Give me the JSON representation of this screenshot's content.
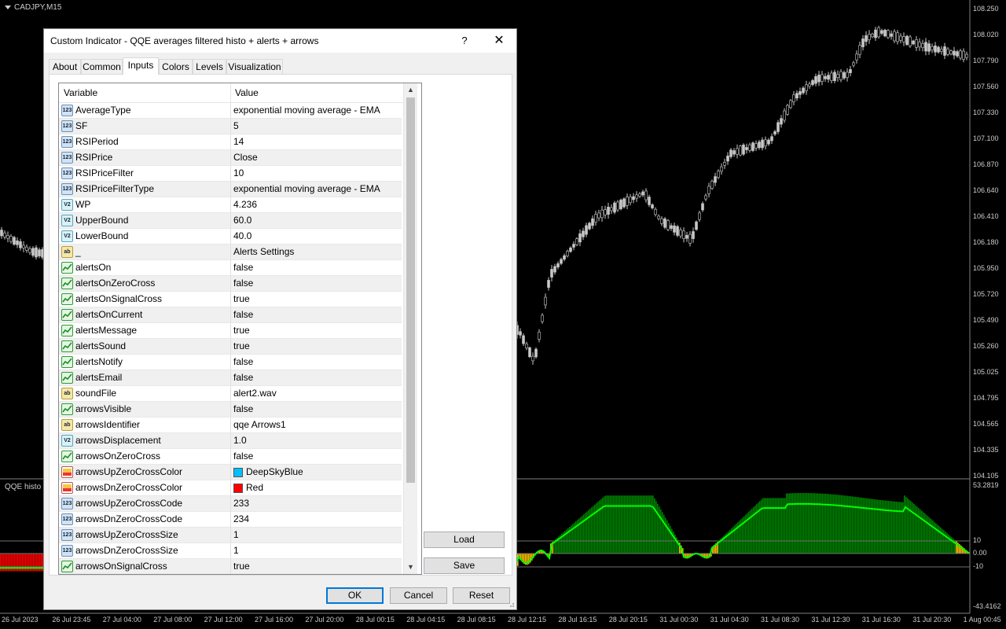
{
  "chart": {
    "symbol": "CADJPY,M15",
    "indicator_label": "QQE histo",
    "price_axis": [
      "108.250",
      "108.020",
      "107.790",
      "107.560",
      "107.330",
      "107.100",
      "106.870",
      "106.640",
      "106.410",
      "106.180",
      "105.950",
      "105.720",
      "105.490",
      "105.260",
      "105.025",
      "104.795",
      "104.565",
      "104.335",
      "104.105"
    ],
    "indicator_axis": [
      "53.2819",
      "10",
      "0.00",
      "-10",
      "-43.4162"
    ],
    "time_axis": [
      "26 Jul 2023",
      "26 Jul 23:45",
      "27 Jul 04:00",
      "27 Jul 08:00",
      "27 Jul 12:00",
      "27 Jul 16:00",
      "27 Jul 20:00",
      "28 Jul 00:15",
      "28 Jul 04:15",
      "28 Jul 08:15",
      "28 Jul 12:15",
      "28 Jul 16:15",
      "28 Jul 20:15",
      "31 Jul 00:30",
      "31 Jul 04:30",
      "31 Jul 08:30",
      "31 Jul 12:30",
      "31 Jul 16:30",
      "31 Jul 20:30",
      "1 Aug 00:45"
    ]
  },
  "dialog": {
    "title": "Custom Indicator - QQE averages filtered histo + alerts + arrows",
    "help": "?",
    "close": "✕",
    "tabs": [
      "About",
      "Common",
      "Inputs",
      "Colors",
      "Levels",
      "Visualization"
    ],
    "active_tab": "Inputs",
    "columns": {
      "variable": "Variable",
      "value": "Value"
    },
    "rows": [
      {
        "type": "int",
        "icon": "123",
        "name": "AverageType",
        "value": "exponential moving average - EMA"
      },
      {
        "type": "int",
        "icon": "123",
        "name": "SF",
        "value": "5"
      },
      {
        "type": "int",
        "icon": "123",
        "name": "RSIPeriod",
        "value": "14"
      },
      {
        "type": "int",
        "icon": "123",
        "name": "RSIPrice",
        "value": "Close"
      },
      {
        "type": "int",
        "icon": "123",
        "name": "RSIPriceFilter",
        "value": "10"
      },
      {
        "type": "int",
        "icon": "123",
        "name": "RSIPriceFilterType",
        "value": "exponential moving average - EMA"
      },
      {
        "type": "dbl",
        "icon": "V2",
        "name": "WP",
        "value": "4.236"
      },
      {
        "type": "dbl",
        "icon": "V2",
        "name": "UpperBound",
        "value": "60.0"
      },
      {
        "type": "dbl",
        "icon": "V2",
        "name": "LowerBound",
        "value": "40.0"
      },
      {
        "type": "str",
        "icon": "ab",
        "name": "_",
        "value": "Alerts Settings"
      },
      {
        "type": "bool",
        "icon": "",
        "name": "alertsOn",
        "value": "false"
      },
      {
        "type": "bool",
        "icon": "",
        "name": "alertsOnZeroCross",
        "value": "false"
      },
      {
        "type": "bool",
        "icon": "",
        "name": "alertsOnSignalCross",
        "value": "true"
      },
      {
        "type": "bool",
        "icon": "",
        "name": "alertsOnCurrent",
        "value": "false"
      },
      {
        "type": "bool",
        "icon": "",
        "name": "alertsMessage",
        "value": "true"
      },
      {
        "type": "bool",
        "icon": "",
        "name": "alertsSound",
        "value": "true"
      },
      {
        "type": "bool",
        "icon": "",
        "name": "alertsNotify",
        "value": "false"
      },
      {
        "type": "bool",
        "icon": "",
        "name": "alertsEmail",
        "value": "false"
      },
      {
        "type": "str",
        "icon": "ab",
        "name": "soundFile",
        "value": "alert2.wav"
      },
      {
        "type": "bool",
        "icon": "",
        "name": "arrowsVisible",
        "value": "false"
      },
      {
        "type": "str",
        "icon": "ab",
        "name": "arrowsIdentifier",
        "value": "qqe Arrows1"
      },
      {
        "type": "dbl",
        "icon": "V2",
        "name": "arrowsDisplacement",
        "value": "1.0"
      },
      {
        "type": "bool",
        "icon": "",
        "name": "arrowsOnZeroCross",
        "value": "false"
      },
      {
        "type": "clr",
        "icon": "",
        "name": "arrowsUpZeroCrossColor",
        "value": "DeepSkyBlue",
        "swatch": "#00bfff"
      },
      {
        "type": "clr",
        "icon": "",
        "name": "arrowsDnZeroCrossColor",
        "value": "Red",
        "swatch": "#ff0000"
      },
      {
        "type": "int",
        "icon": "123",
        "name": "arrowsUpZeroCrossCode",
        "value": "233"
      },
      {
        "type": "int",
        "icon": "123",
        "name": "arrowsDnZeroCrossCode",
        "value": "234"
      },
      {
        "type": "int",
        "icon": "123",
        "name": "arrowsUpZeroCrossSize",
        "value": "1"
      },
      {
        "type": "int",
        "icon": "123",
        "name": "arrowsDnZeroCrossSize",
        "value": "1"
      },
      {
        "type": "bool",
        "icon": "",
        "name": "arrowsOnSignalCross",
        "value": "true"
      }
    ],
    "buttons": {
      "load": "Load",
      "save": "Save",
      "ok": "OK",
      "cancel": "Cancel",
      "reset": "Reset"
    }
  },
  "colors": {
    "bull_histo": "#008000",
    "signal_line": "#00ff00",
    "bear_histo": "#ff0000",
    "neutral_histo": "#ffbf00",
    "candle": "#c8c8c8"
  }
}
